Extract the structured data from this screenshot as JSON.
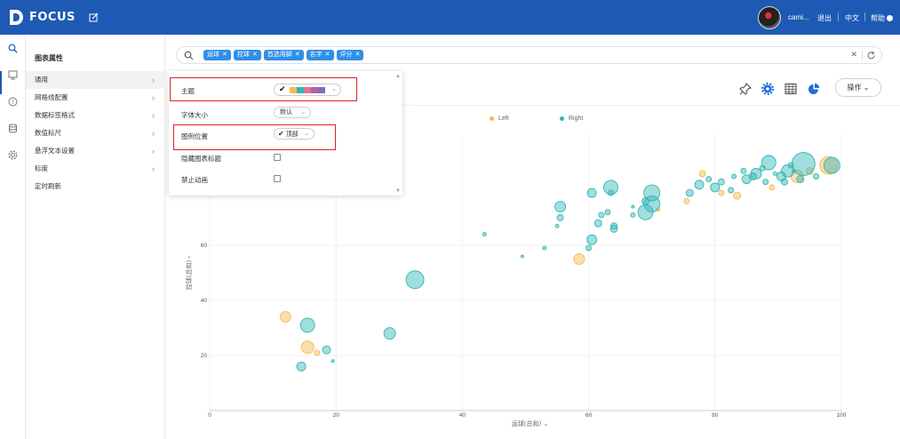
{
  "header": {
    "logo_text": "FOCUS",
    "user_name": "cami...",
    "logout": "退出",
    "language": "中文",
    "help": "帮助",
    "brand_color": "#1e5ab4"
  },
  "rail": {
    "icons": [
      "search-icon",
      "board-icon",
      "question-icon",
      "data-icon",
      "settings-icon"
    ]
  },
  "sidebar": {
    "title": "图表属性",
    "items": [
      {
        "label": "通用"
      },
      {
        "label": "网格线配置"
      },
      {
        "label": "数据标签格式"
      },
      {
        "label": "数值标尺"
      },
      {
        "label": "悬浮文本设置"
      },
      {
        "label": "标度"
      },
      {
        "label": "定时刷新"
      }
    ]
  },
  "search": {
    "tags": [
      "运球",
      "控球",
      "首选用脚",
      "名字",
      "评分"
    ],
    "tag_color": "#2f8fe8"
  },
  "toolbar": {
    "operate_label": "操作",
    "icons": [
      "pin-icon",
      "gear-icon",
      "table-icon",
      "pie-chart-icon"
    ]
  },
  "panel": {
    "theme_label": "主题",
    "font_size_label": "字体大小",
    "font_size_value": "默认",
    "legend_pos_label": "图例位置",
    "legend_pos_value": "顶部",
    "hide_title_label": "隐藏图表标题",
    "disable_anim_label": "禁止动画",
    "theme_colors": [
      "#f5b94d",
      "#2fb5b5",
      "#e6728a",
      "#b55fa8",
      "#7e6bc9"
    ]
  },
  "chart_data": {
    "type": "scatter",
    "xlabel": "运球(总和)",
    "ylabel": "控球(总和)",
    "xlim": [
      0,
      100
    ],
    "ylim": [
      0,
      100
    ],
    "xticks": [
      0,
      20,
      40,
      60,
      80,
      100
    ],
    "yticks": [
      20,
      40,
      60
    ],
    "legend_position": "top",
    "series": [
      {
        "name": "Left",
        "color": "#f5b94d",
        "points": [
          {
            "x": 12,
            "y": 34,
            "r": 6
          },
          {
            "x": 15.5,
            "y": 23,
            "r": 7
          },
          {
            "x": 17,
            "y": 21,
            "r": 3
          },
          {
            "x": 58.5,
            "y": 55,
            "r": 6
          },
          {
            "x": 71,
            "y": 73,
            "r": 2
          },
          {
            "x": 75.5,
            "y": 76,
            "r": 3
          },
          {
            "x": 78,
            "y": 86,
            "r": 3.5
          },
          {
            "x": 81,
            "y": 79,
            "r": 3
          },
          {
            "x": 83.5,
            "y": 78,
            "r": 4
          },
          {
            "x": 89,
            "y": 81,
            "r": 3
          },
          {
            "x": 93,
            "y": 85,
            "r": 7
          },
          {
            "x": 95,
            "y": 87,
            "r": 4
          },
          {
            "x": 98,
            "y": 89,
            "r": 10
          }
        ]
      },
      {
        "name": "Right",
        "color": "#2fb5b5",
        "points": [
          {
            "x": 14.5,
            "y": 16,
            "r": 5
          },
          {
            "x": 15.5,
            "y": 31,
            "r": 8
          },
          {
            "x": 18.5,
            "y": 22,
            "r": 4.5
          },
          {
            "x": 19.5,
            "y": 18,
            "r": 1.5
          },
          {
            "x": 28.5,
            "y": 28,
            "r": 6.5
          },
          {
            "x": 32.5,
            "y": 47.5,
            "r": 10
          },
          {
            "x": 43.5,
            "y": 64,
            "r": 2
          },
          {
            "x": 49.5,
            "y": 56,
            "r": 1.5
          },
          {
            "x": 53,
            "y": 59,
            "r": 2
          },
          {
            "x": 55,
            "y": 67,
            "r": 2
          },
          {
            "x": 55.5,
            "y": 74,
            "r": 6
          },
          {
            "x": 55.5,
            "y": 70,
            "r": 3.5
          },
          {
            "x": 60,
            "y": 59,
            "r": 3
          },
          {
            "x": 60.5,
            "y": 62,
            "r": 5.5
          },
          {
            "x": 60.5,
            "y": 79,
            "r": 5
          },
          {
            "x": 61.5,
            "y": 68,
            "r": 4
          },
          {
            "x": 62,
            "y": 71,
            "r": 3
          },
          {
            "x": 63,
            "y": 72,
            "r": 3
          },
          {
            "x": 63.5,
            "y": 79,
            "r": 3
          },
          {
            "x": 64,
            "y": 66,
            "r": 4
          },
          {
            "x": 64,
            "y": 67,
            "r": 3.5
          },
          {
            "x": 63.5,
            "y": 81,
            "r": 8
          },
          {
            "x": 67,
            "y": 71,
            "r": 2.5
          },
          {
            "x": 67,
            "y": 74,
            "r": 1.5
          },
          {
            "x": 69,
            "y": 76,
            "r": 4
          },
          {
            "x": 69,
            "y": 72,
            "r": 8.5
          },
          {
            "x": 70,
            "y": 75,
            "r": 9
          },
          {
            "x": 70,
            "y": 79,
            "r": 9
          },
          {
            "x": 76,
            "y": 79,
            "r": 4
          },
          {
            "x": 77.5,
            "y": 82,
            "r": 5
          },
          {
            "x": 79,
            "y": 84,
            "r": 3
          },
          {
            "x": 80,
            "y": 81,
            "r": 5
          },
          {
            "x": 81,
            "y": 83,
            "r": 3.5
          },
          {
            "x": 82.5,
            "y": 80,
            "r": 3
          },
          {
            "x": 83,
            "y": 85,
            "r": 2.5
          },
          {
            "x": 84.5,
            "y": 87,
            "r": 3
          },
          {
            "x": 85,
            "y": 84,
            "r": 5
          },
          {
            "x": 86,
            "y": 85,
            "r": 4
          },
          {
            "x": 86.5,
            "y": 86,
            "r": 6
          },
          {
            "x": 87.5,
            "y": 88,
            "r": 3
          },
          {
            "x": 88,
            "y": 83,
            "r": 3
          },
          {
            "x": 88.5,
            "y": 90,
            "r": 8
          },
          {
            "x": 89.5,
            "y": 86,
            "r": 2
          },
          {
            "x": 90.5,
            "y": 85,
            "r": 5
          },
          {
            "x": 91,
            "y": 83,
            "r": 3.5
          },
          {
            "x": 91.5,
            "y": 87,
            "r": 7
          },
          {
            "x": 92,
            "y": 89,
            "r": 3
          },
          {
            "x": 92.5,
            "y": 87,
            "r": 2
          },
          {
            "x": 93.5,
            "y": 84,
            "r": 4
          },
          {
            "x": 94,
            "y": 89.5,
            "r": 13
          },
          {
            "x": 96,
            "y": 85,
            "r": 3
          },
          {
            "x": 98.5,
            "y": 89,
            "r": 9
          }
        ]
      }
    ]
  }
}
